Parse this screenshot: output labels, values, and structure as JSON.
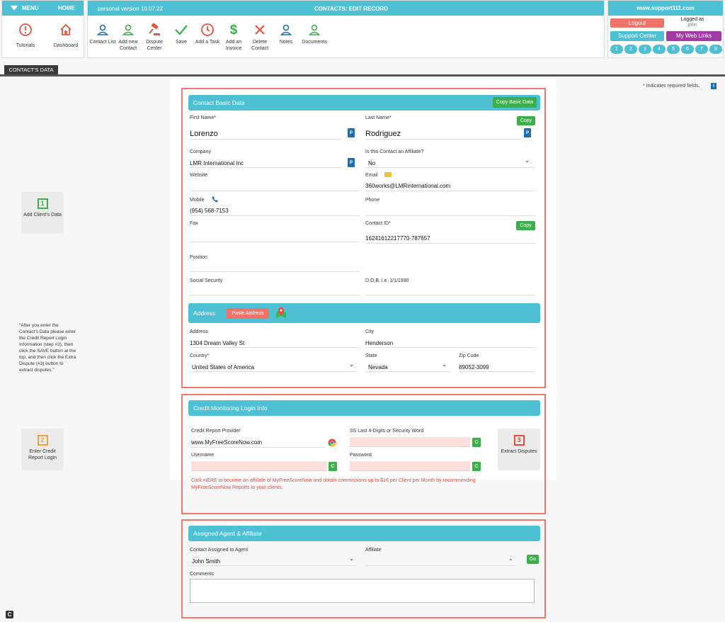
{
  "menu": {
    "title": "MENU",
    "home": "HOME",
    "tutorials": "Tutorials",
    "dashboard": "Dashboard"
  },
  "toolbar": {
    "version": "personal version 10.07.22",
    "title": "CONTACTS: EDIT RECORD",
    "buttons": [
      {
        "label": "Contact List",
        "icon": "person-icon"
      },
      {
        "label": "Add new Contact",
        "icon": "add-person-icon"
      },
      {
        "label": "Dispute Center",
        "icon": "gavel-icon"
      },
      {
        "label": "Save",
        "icon": "check-icon"
      },
      {
        "label": "Add a Task",
        "icon": "clock-icon"
      },
      {
        "label": "Add an Invoice",
        "icon": "dollar-icon"
      },
      {
        "label": "Delete Contact",
        "icon": "x-icon"
      },
      {
        "label": "Notes",
        "icon": "person-icon"
      },
      {
        "label": "Documents",
        "icon": "person-icon"
      }
    ]
  },
  "site": {
    "url": "www.support111.com",
    "logout": "Logout",
    "logged_as": "Logged as",
    "user": "john",
    "support_center": "Support Center",
    "web_links": "My Web Links",
    "numbers": [
      "1",
      "2",
      "3",
      "4",
      "5",
      "6",
      "7",
      "8"
    ]
  },
  "tab": "CONTACT'S DATA",
  "required_note": "* Indicates required fields.",
  "steps": {
    "s1": {
      "num": "1",
      "label": "Add Client's Data"
    },
    "s2": {
      "num": "2",
      "label": "Enter Credit Report Login"
    },
    "s3": {
      "num": "3",
      "label": "Extract Disputes"
    }
  },
  "side_note": "\"After you enter the Contact's Data please enter the Credit Report Login Information (step #2), then click the SAVE button at the top, and then click the Extra Dispute (#3) button to extract disputes.\"",
  "basic": {
    "header": "Contact Basic Data",
    "copy_basic": "Copy Basic Data",
    "copy": "Copy",
    "p": "P",
    "first_name_label": "First Name*",
    "first_name": "Lorenzo",
    "last_name_label": "Last Name*",
    "last_name": "Rodriguez",
    "company_label": "Company",
    "company": "LMR International Inc",
    "affiliate_q_label": "Is this Contact an Affiliate?",
    "affiliate_q": "No",
    "website_label": "Website",
    "website": "",
    "email_label": "Email",
    "email": "360works@LMRinternational.com",
    "mobile_label": "Mobile",
    "mobile": "(954) 568-7153",
    "phone_label": "Phone",
    "phone": "",
    "fax_label": "Fax",
    "fax": "",
    "contact_id_label": "Contact ID*",
    "contact_id": "16241612217770-787657",
    "position_label": "Position",
    "ss_label": "Social Security",
    "dob_label": "D.O.B. i.e. 1/1/1990"
  },
  "address": {
    "header": "Address",
    "paste": "Paste Address",
    "address_label": "Address",
    "address": "1304 Dream Valley St",
    "city_label": "City",
    "city": "Henderson",
    "country_label": "Country*",
    "country": "United States of America",
    "state_label": "State",
    "state": "Nevada",
    "zip_label": "Zip Code",
    "zip": "89052-3099"
  },
  "credit": {
    "header": "Credit Monitoring Login Info",
    "provider_label": "Credit Report Provider",
    "provider": "www.MyFreeScoreNow.com",
    "ss4_label": "SS Last 4-Digits or Security Word",
    "username_label": "Username",
    "password_label": "Password",
    "c": "C",
    "affiliate_link_1": "Click HERE to become an affiliate of MyFreeScoreNow and obtain commissions up to $16 per Client per Month by recommending",
    "affiliate_link_2": "MyFreeScoreNow Reports to your clients."
  },
  "agent": {
    "header": "Assigned Agent & Affiliate",
    "agent_label": "Contact Assigned to Agent",
    "agent": "John Smith",
    "affiliate_label": "Affiliate",
    "affiliate": "",
    "go": "Go",
    "comments_label": "Comments"
  },
  "colors": {
    "teal": "#4dc0d4",
    "red": "#f07870",
    "green": "#3bb04a",
    "purple": "#a23aa6",
    "blue": "#1a6fb5"
  }
}
